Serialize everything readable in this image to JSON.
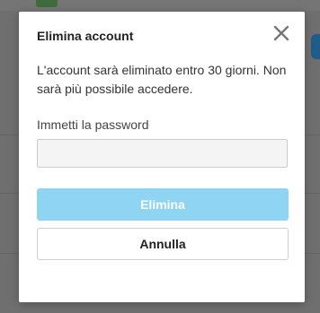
{
  "dialog": {
    "title": "Elimina account",
    "message": "L'account sarà eliminato entro 30 giorni. Non sarà più possibile accedere.",
    "password_label": "Immetti la password",
    "password_value": "",
    "delete_label": "Elimina",
    "cancel_label": "Annulla",
    "close_icon": "close-icon"
  },
  "colors": {
    "overlay": "#6f6f6f",
    "dialog_bg": "#ffffff",
    "delete_button_bg": "#8fd4f2",
    "delete_button_text": "#ffffff",
    "input_bg": "#f4f4f4"
  }
}
